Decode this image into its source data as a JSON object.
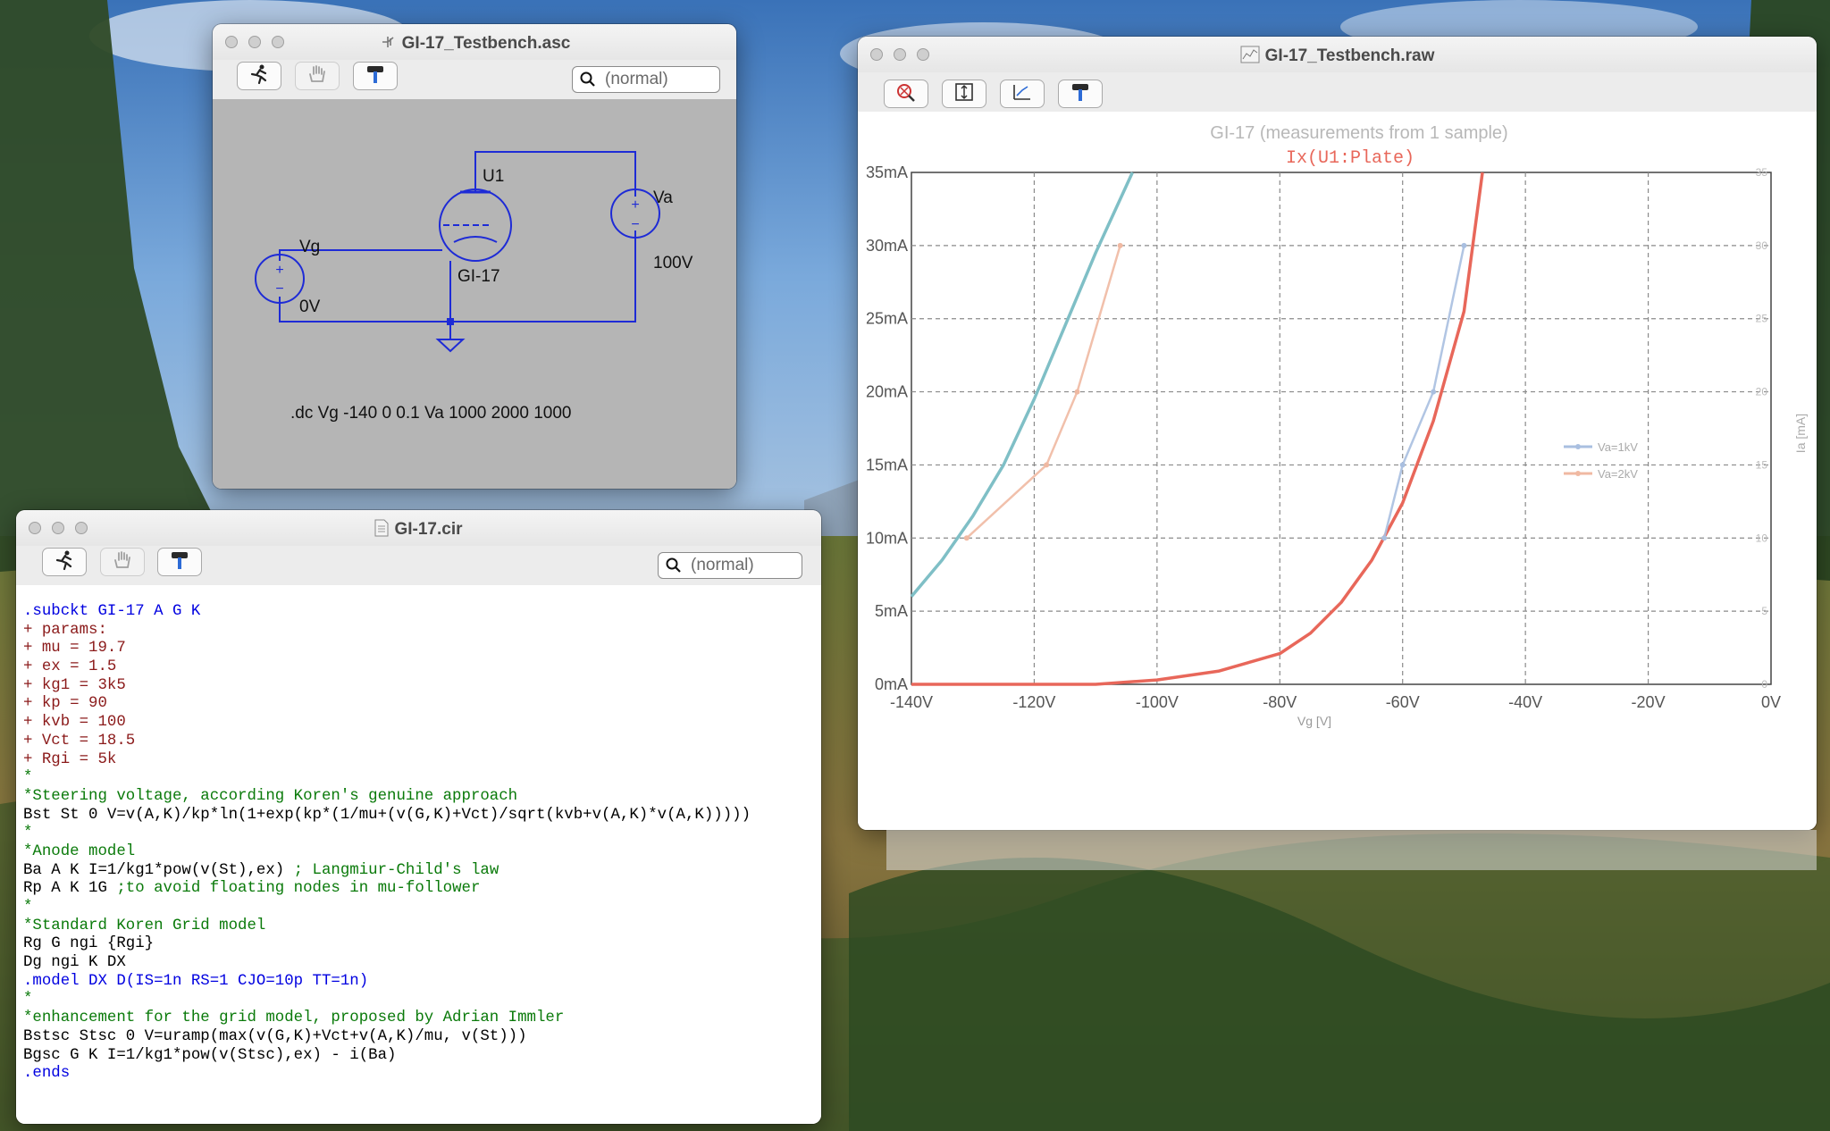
{
  "colors": {
    "trace_red": "#e8675a",
    "trace_teal": "#7fbfc6",
    "wire_blue": "#1e2bd6",
    "param_red": "#8b1a1a",
    "comment_green": "#0a7a0a",
    "directive_blue": "#0000e0"
  },
  "schematic": {
    "title": "GI-17_Testbench.asc",
    "search_placeholder": "(normal)",
    "labels": {
      "tube_ref": "U1",
      "tube_model": "GI-17",
      "vg_name": "Vg",
      "vg_value": "0V",
      "va_name": "Va",
      "va_value": "100V"
    },
    "directive": ".dc Vg -140 0 0.1 Va 1000 2000 1000",
    "toolbar": [
      "run-icon",
      "hand-icon",
      "hammer-icon"
    ]
  },
  "netlist": {
    "title": "GI-17.cir",
    "search_placeholder": "(normal)",
    "lines": [
      {
        "text": ".subckt GI-17 A G K",
        "style": "blue"
      },
      {
        "text": "+ params:",
        "style": "red"
      },
      {
        "text": "+ mu = 19.7",
        "style": "red"
      },
      {
        "text": "+ ex = 1.5",
        "style": "red"
      },
      {
        "text": "+ kg1 = 3k5",
        "style": "red"
      },
      {
        "text": "+ kp = 90",
        "style": "red"
      },
      {
        "text": "+ kvb = 100",
        "style": "red"
      },
      {
        "text": "+ Vct = 18.5",
        "style": "red"
      },
      {
        "text": "+ Rgi = 5k",
        "style": "red"
      },
      {
        "text": "*",
        "style": "green"
      },
      {
        "text": "*Steering voltage, according Koren's genuine approach",
        "style": "green"
      },
      {
        "text": "Bst St 0 V=v(A,K)/kp*ln(1+exp(kp*(1/mu+(v(G,K)+Vct)/sqrt(kvb+v(A,K)*v(A,K)))))",
        "style": "black"
      },
      {
        "text": "*",
        "style": "green"
      },
      {
        "text": "*Anode model",
        "style": "green"
      },
      {
        "text": "Ba A K I=1/kg1*pow(v(St),ex) ",
        "style": "black",
        "comment": "; Langmiur-Child's law"
      },
      {
        "text": "Rp A K 1G ",
        "style": "black",
        "comment": ";to avoid floating nodes in mu-follower"
      },
      {
        "text": "*",
        "style": "green"
      },
      {
        "text": "*Standard Koren Grid model",
        "style": "green"
      },
      {
        "text": "Rg G ngi {Rgi}",
        "style": "black"
      },
      {
        "text": "Dg ngi K DX",
        "style": "black"
      },
      {
        "text": ".model DX D(IS=1n RS=1 CJO=10p TT=1n)",
        "style": "blue"
      },
      {
        "text": "*",
        "style": "green"
      },
      {
        "text": "*enhancement for the grid model, proposed by Adrian Immler",
        "style": "green"
      },
      {
        "text": "Bstsc Stsc 0 V=uramp(max(v(G,K)+Vct+v(A,K)/mu, v(St)))",
        "style": "black"
      },
      {
        "text": "Bgsc G K I=1/kg1*pow(v(Stsc),ex) - i(Ba)",
        "style": "black"
      },
      {
        "text": ".ends",
        "style": "blue"
      }
    ]
  },
  "waveform": {
    "title": "GI-17_Testbench.raw",
    "toolbar": [
      "zoom-icon",
      "autorange-icon",
      "cursor-icon",
      "hammer-icon"
    ],
    "overlay_title": "GI-17 (measurements from 1 sample)",
    "overlay_legend": [
      "Va=1kV",
      "Va=2kV"
    ],
    "overlay_xlabel": "Vg [V]",
    "overlay_ylabel": "Ia [mA]",
    "overlay_right_ticks": [
      "35",
      "30",
      "25",
      "20",
      "15",
      "10",
      "5",
      "0"
    ],
    "chart_data": {
      "type": "line",
      "title": "Ix(U1:Plate)",
      "xlim": [
        -140,
        0
      ],
      "ylim": [
        0,
        35
      ],
      "x_ticks": [
        "-140V",
        "-120V",
        "-100V",
        "-80V",
        "-60V",
        "-40V",
        "-20V",
        "0V"
      ],
      "y_ticks": [
        "0mA",
        "5mA",
        "10mA",
        "15mA",
        "20mA",
        "25mA",
        "30mA",
        "35mA"
      ],
      "grid": true,
      "series": [
        {
          "color": "#7fbfc6",
          "x": [
            -140,
            -135,
            -130,
            -125,
            -120,
            -115,
            -110,
            -104
          ],
          "y": [
            6,
            8.5,
            11.5,
            15,
            19.5,
            24.5,
            29.5,
            35
          ]
        },
        {
          "color": "#e8675a",
          "x": [
            -140,
            -110,
            -100,
            -90,
            -80,
            -75,
            -70,
            -65,
            -60,
            -55,
            -50,
            -47
          ],
          "y": [
            0,
            0,
            0.3,
            0.9,
            2.1,
            3.5,
            5.6,
            8.5,
            12.4,
            18,
            25.5,
            35
          ]
        },
        {
          "name": "Va=1kV",
          "color": "#a9bfe0",
          "x": [
            -63,
            -60,
            -55,
            -50
          ],
          "y": [
            10,
            15,
            20,
            30
          ]
        },
        {
          "name": "Va=2kV",
          "color": "#f0b9a2",
          "x": [
            -131,
            -118,
            -113,
            -106
          ],
          "y": [
            10,
            15,
            20,
            30
          ]
        }
      ]
    }
  }
}
